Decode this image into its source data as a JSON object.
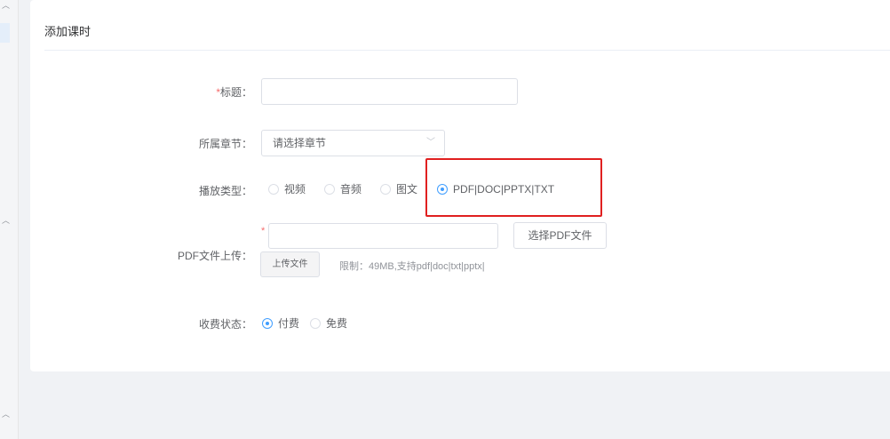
{
  "card": {
    "title": "添加课时"
  },
  "form": {
    "title_field": {
      "required_mark": "*",
      "label": "标题：",
      "value": ""
    },
    "chapter_field": {
      "label": "所属章节：",
      "value": "请选择章节"
    },
    "play_type": {
      "label": "播放类型：",
      "options": [
        {
          "label": "视频",
          "checked": false
        },
        {
          "label": "音频",
          "checked": false
        },
        {
          "label": "图文",
          "checked": false
        },
        {
          "label": "PDF|DOC|PPTX|TXT",
          "checked": true
        }
      ]
    },
    "pdf_upload": {
      "label": "PDF文件上传：",
      "required_mark": "*",
      "value": "",
      "choose_button": "选择PDF文件",
      "upload_button": "上传文件",
      "limit_hint": "限制：49MB,支持pdf|doc|txt|pptx|"
    },
    "fee_status": {
      "label": "收费状态：",
      "options": [
        {
          "label": "付费",
          "checked": true
        },
        {
          "label": "免费",
          "checked": false
        }
      ]
    }
  },
  "colors": {
    "accent": "#409eff",
    "highlight": "#e02020",
    "required": "#f56c6c"
  },
  "icons": {
    "select_arrow": "chevron-down-icon",
    "sidebar_collapse": "chevron-up-icon"
  }
}
